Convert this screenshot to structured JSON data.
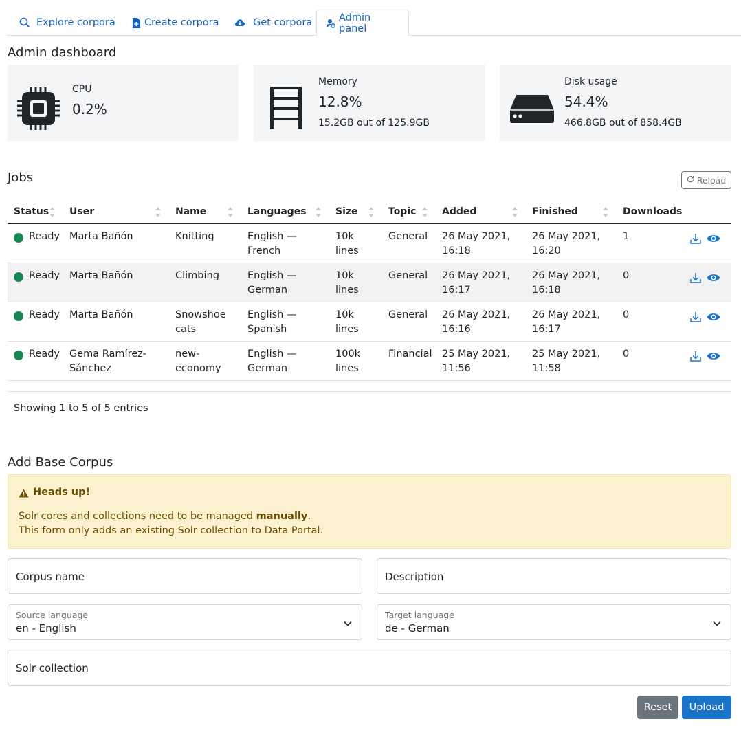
{
  "tabs": [
    {
      "label": "Explore corpora",
      "icon": "search-icon"
    },
    {
      "label": "Create corpora",
      "icon": "file-plus-icon"
    },
    {
      "label": "Get corpora",
      "icon": "cloud-download-icon"
    },
    {
      "label": "Admin panel",
      "icon": "admin-icon"
    }
  ],
  "dashboard": {
    "title": "Admin dashboard",
    "cpu": {
      "label": "CPU",
      "value": "0.2%"
    },
    "memory": {
      "label": "Memory",
      "value": "12.8%",
      "detail": "15.2GB out of 125.9GB"
    },
    "disk": {
      "label": "Disk usage",
      "value": "54.4%",
      "detail": "466.8GB out of 858.4GB"
    }
  },
  "jobs": {
    "title": "Jobs",
    "reload_label": "Reload",
    "columns": [
      "Status",
      "User",
      "Name",
      "Languages",
      "Size",
      "Topic",
      "Added",
      "Finished",
      "Downloads"
    ],
    "rows": [
      {
        "status": "Ready",
        "user": "Marta Bañón",
        "user2": "",
        "name": "Knitting",
        "name2": "",
        "lang1": "English —",
        "lang2": "French",
        "size1": "10k",
        "size2": "lines",
        "topic": "General",
        "added1": "26 May 2021,",
        "added2": "16:18",
        "fin1": "26 May 2021,",
        "fin2": "16:20",
        "downloads": "1"
      },
      {
        "status": "Ready",
        "user": "Marta Bañón",
        "user2": "",
        "name": "Climbing",
        "name2": "",
        "lang1": "English —",
        "lang2": "German",
        "size1": "10k",
        "size2": "lines",
        "topic": "General",
        "added1": "26 May 2021,",
        "added2": "16:17",
        "fin1": "26 May 2021,",
        "fin2": "16:18",
        "downloads": "0"
      },
      {
        "status": "Ready",
        "user": "Marta Bañón",
        "user2": "",
        "name": "Snowshoe",
        "name2": "cats",
        "lang1": "English —",
        "lang2": "Spanish",
        "size1": "10k",
        "size2": "lines",
        "topic": "General",
        "added1": "26 May 2021,",
        "added2": "16:16",
        "fin1": "26 May 2021,",
        "fin2": "16:17",
        "downloads": "0"
      },
      {
        "status": "Ready",
        "user": "Gema Ramírez-",
        "user2": "Sánchez",
        "name": "new-",
        "name2": "economy",
        "lang1": "English —",
        "lang2": "German",
        "size1": "100k",
        "size2": "lines",
        "topic": "Financial",
        "added1": "25 May 2021,",
        "added2": "11:56",
        "fin1": "25 May 2021,",
        "fin2": "11:58",
        "downloads": "0"
      }
    ],
    "showing": "Showing 1 to 5 of 5 entries"
  },
  "base_corpus": {
    "title": "Add Base Corpus",
    "alert": {
      "title": "Heads up!",
      "line1_prefix": "Solr cores and collections need to be managed ",
      "line1_bold": "manually",
      "line1_suffix": ".",
      "line2": "This form only adds an existing Solr collection to Data Portal."
    },
    "corpus_name_placeholder": "Corpus name",
    "description_placeholder": "Description",
    "source_language": {
      "label": "Source language",
      "value": "en - English"
    },
    "target_language": {
      "label": "Target language",
      "value": "de - German"
    },
    "solr_placeholder": "Solr collection",
    "reset_label": "Reset",
    "upload_label": "Upload"
  },
  "colors": {
    "accent": "#1a73c8",
    "ready": "#198754",
    "alert_bg": "#fcf1cf",
    "card_bg": "#f4f5f6"
  }
}
